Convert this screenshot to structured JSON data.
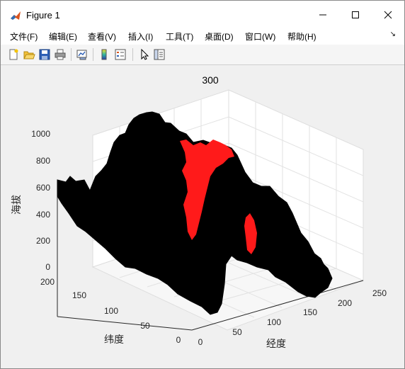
{
  "window": {
    "title": "Figure 1"
  },
  "menu": {
    "items": [
      "文件(F)",
      "编辑(E)",
      "查看(V)",
      "插入(I)",
      "工具(T)",
      "桌面(D)",
      "窗口(W)",
      "帮助(H)"
    ]
  },
  "toolbar": {
    "icons": [
      "new-figure-icon",
      "open-file-icon",
      "save-icon",
      "print-icon",
      "link-plot-icon",
      "colorbar-icon",
      "legend-icon",
      "pointer-icon",
      "property-editor-icon"
    ]
  },
  "plot": {
    "title": "300",
    "zlabel": "海拔",
    "xlabel": "经度",
    "ylabel": "纬度",
    "z_ticks": [
      "0",
      "200",
      "400",
      "600",
      "800",
      "1000"
    ],
    "x_ticks": [
      "0",
      "50",
      "100",
      "150",
      "200",
      "250"
    ],
    "y_ticks": [
      "0",
      "50",
      "100",
      "150",
      "200"
    ],
    "surface_color": "#000000",
    "highlight_color": "#ff1a1a"
  },
  "chart_data": {
    "type": "surface",
    "title": "300",
    "xlabel": "经度",
    "ylabel": "纬度",
    "zlabel": "海拔",
    "xlim": [
      0,
      250
    ],
    "ylim": [
      0,
      200
    ],
    "zlim": [
      0,
      1000
    ],
    "grid": true,
    "series": [
      {
        "color": "#000000"
      },
      {
        "color": "#ff1a1a"
      }
    ]
  }
}
